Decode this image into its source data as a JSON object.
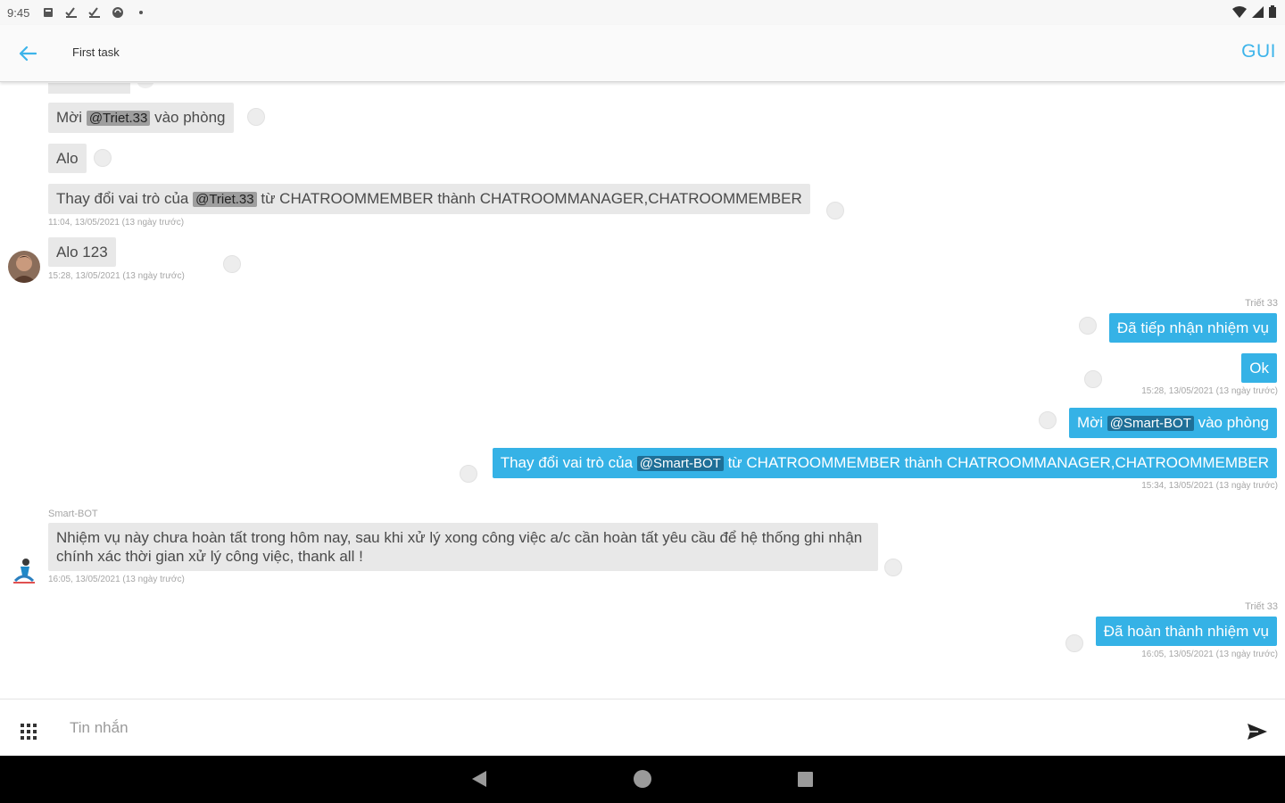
{
  "status_bar": {
    "time": "9:45",
    "icons": [
      "notification-icon",
      "task-check-icon",
      "task-check-icon",
      "sync-icon",
      "dot-icon",
      "wifi-icon",
      "signal-icon",
      "battery-icon"
    ]
  },
  "app_bar": {
    "title": "First task",
    "send_label": "GUI",
    "accent_color": "#3db4ea"
  },
  "messages": {
    "m1": {
      "prefix": "Mời",
      "mention": "@Triet.33",
      "suffix": "vào phòng"
    },
    "m2": {
      "text": "Alo"
    },
    "m3": {
      "prefix": "Thay đổi vai trò của",
      "mention": "@Triet.33",
      "suffix": "từ CHATROOMMEMBER thành CHATROOMMANAGER,CHATROOMMEMBER",
      "meta": "11:04, 13/05/2021 (13 ngày trước)"
    },
    "m4": {
      "text": "Alo 123",
      "meta": "15:28, 13/05/2021 (13 ngày trước)"
    },
    "m5": {
      "sender": "Triết 33",
      "text": "Đã tiếp nhận nhiệm vụ"
    },
    "m6": {
      "text": "Ok",
      "meta": "15:28, 13/05/2021 (13 ngày trước)"
    },
    "m7": {
      "prefix": "Mời",
      "mention": "@Smart-BOT",
      "suffix": "vào phòng"
    },
    "m8": {
      "prefix": "Thay đổi vai trò của",
      "mention": "@Smart-BOT",
      "suffix": "từ CHATROOMMEMBER thành CHATROOMMANAGER,CHATROOMMEMBER",
      "meta": "15:34, 13/05/2021 (13 ngày trước)"
    },
    "m9": {
      "sender": "Smart-BOT",
      "text": "Nhiệm vụ này chưa hoàn tất trong hôm nay, sau khi xử lý xong công việc a/c cần hoàn tất yêu cầu để hệ thống ghi nhận chính xác thời gian xử lý công việc, thank all !",
      "meta": "16:05, 13/05/2021 (13 ngày trước)"
    },
    "m10": {
      "sender": "Triết 33",
      "text": "Đã hoàn thành nhiệm vụ",
      "meta": "16:05, 13/05/2021 (13 ngày trước)"
    }
  },
  "composer": {
    "placeholder": "Tin nhắn"
  },
  "colors": {
    "incoming_bubble": "#e8e8e8",
    "outgoing_bubble": "#35b2e6"
  }
}
